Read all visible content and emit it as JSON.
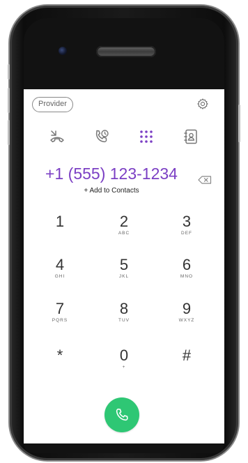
{
  "header": {
    "provider_label": "Provider"
  },
  "tabs": [
    {
      "name": "recent-calls",
      "icon": "missed-call-icon"
    },
    {
      "name": "voicemail",
      "icon": "phone-history-icon"
    },
    {
      "name": "keypad",
      "icon": "keypad-grid-icon",
      "active": true
    },
    {
      "name": "contacts",
      "icon": "contact-book-icon"
    }
  ],
  "dialer": {
    "number": "+1 (555) 123-1234",
    "add_contact_label": "+ Add to Contacts"
  },
  "keypad": [
    {
      "digit": "1",
      "letters": ""
    },
    {
      "digit": "2",
      "letters": "ABC"
    },
    {
      "digit": "3",
      "letters": "DEF"
    },
    {
      "digit": "4",
      "letters": "GHI"
    },
    {
      "digit": "5",
      "letters": "JKL"
    },
    {
      "digit": "6",
      "letters": "MNO"
    },
    {
      "digit": "7",
      "letters": "PQRS"
    },
    {
      "digit": "8",
      "letters": "TUV"
    },
    {
      "digit": "9",
      "letters": "WXYZ"
    },
    {
      "digit": "*",
      "letters": ""
    },
    {
      "digit": "0",
      "letters": "+"
    },
    {
      "digit": "#",
      "letters": ""
    }
  ],
  "colors": {
    "accent": "#7b3fc4",
    "call_button": "#2ec774",
    "icon_gray": "#777777"
  }
}
